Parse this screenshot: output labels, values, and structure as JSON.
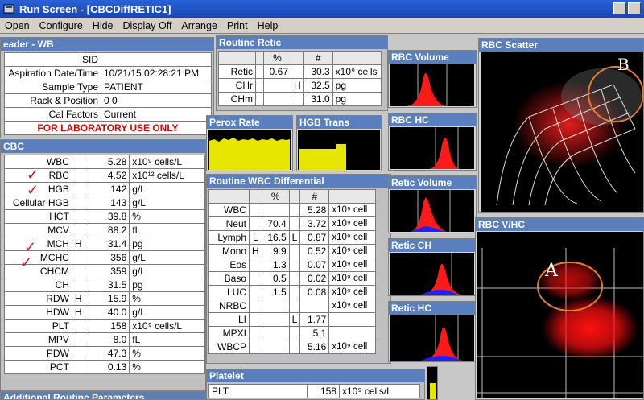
{
  "window": {
    "title": "Run Screen - [CBCDiffRETIC1]"
  },
  "menu": [
    "Open",
    "Configure",
    "Hide",
    "Display Off",
    "Arrange",
    "Print",
    "Help"
  ],
  "header": {
    "title": "eader - WB",
    "rows": [
      {
        "label": "SID",
        "value": ""
      },
      {
        "label": "Aspiration Date/Time",
        "value": "10/21/15 02:28:21 PM"
      },
      {
        "label": "Sample Type",
        "value": "PATIENT"
      },
      {
        "label": "Rack & Position",
        "value": "0 0"
      },
      {
        "label": "Cal Factors",
        "value": "Current"
      }
    ],
    "notice": "FOR LABORATORY USE ONLY"
  },
  "cbc": {
    "title": "CBC",
    "rows": [
      {
        "name": "WBC",
        "flag": "",
        "value": "5.28",
        "unit": "x10⁹ cells/L"
      },
      {
        "name": "RBC",
        "flag": "",
        "value": "4.52",
        "unit": "x10¹² cells/L"
      },
      {
        "name": "HGB",
        "flag": "",
        "value": "142",
        "unit": "g/L"
      },
      {
        "name": "Cellular HGB",
        "flag": "",
        "value": "143",
        "unit": "g/L"
      },
      {
        "name": "HCT",
        "flag": "",
        "value": "39.8",
        "unit": "%"
      },
      {
        "name": "MCV",
        "flag": "",
        "value": "88.2",
        "unit": "fL"
      },
      {
        "name": "MCH",
        "flag": "H",
        "value": "31.4",
        "unit": "pg"
      },
      {
        "name": "MCHC",
        "flag": "",
        "value": "356",
        "unit": "g/L"
      },
      {
        "name": "CHCM",
        "flag": "",
        "value": "359",
        "unit": "g/L"
      },
      {
        "name": "CH",
        "flag": "",
        "value": "31.5",
        "unit": "pg"
      },
      {
        "name": "RDW",
        "flag": "H",
        "value": "15.9",
        "unit": "%"
      },
      {
        "name": "HDW",
        "flag": "H",
        "value": "40.0",
        "unit": "g/L"
      },
      {
        "name": "PLT",
        "flag": "",
        "value": "158",
        "unit": "x10⁹ cells/L"
      },
      {
        "name": "MPV",
        "flag": "",
        "value": "8.0",
        "unit": "fL"
      },
      {
        "name": "PDW",
        "flag": "",
        "value": "47.3",
        "unit": "%"
      },
      {
        "name": "PCT",
        "flag": "",
        "value": "0.13",
        "unit": "%"
      }
    ],
    "checkmark": "✓"
  },
  "additional": {
    "title": "Additional Routine Parameters"
  },
  "retic": {
    "title": "Routine Retic",
    "headers": [
      "%",
      "#"
    ],
    "rows": [
      {
        "name": "Retic",
        "pf": "",
        "pct": "0.67",
        "nf": "",
        "num": "30.3",
        "unit": "x10⁹ cells"
      },
      {
        "name": "CHr",
        "pf": "",
        "pct": "",
        "nf": "H",
        "num": "32.5",
        "unit": "pg"
      },
      {
        "name": "CHm",
        "pf": "",
        "pct": "",
        "nf": "",
        "num": "31.0",
        "unit": "pg"
      }
    ]
  },
  "perox": {
    "title": "Perox Rate"
  },
  "hgbtrans": {
    "title": "HGB Trans"
  },
  "wbcdiff": {
    "title": "Routine WBC Differential",
    "headers": [
      "%",
      "#"
    ],
    "rows": [
      {
        "name": "WBC",
        "pf": "",
        "pct": "",
        "nf": "",
        "num": "5.28",
        "unit": "x10⁹ cell"
      },
      {
        "name": "Neut",
        "pf": "",
        "pct": "70.4",
        "nf": "",
        "num": "3.72",
        "unit": "x10⁹ cell"
      },
      {
        "name": "Lymph",
        "pf": "L",
        "pct": "16.5",
        "nf": "L",
        "num": "0.87",
        "unit": "x10⁹ cell"
      },
      {
        "name": "Mono",
        "pf": "H",
        "pct": "9.9",
        "nf": "",
        "num": "0.52",
        "unit": "x10⁹ cell"
      },
      {
        "name": "Eos",
        "pf": "",
        "pct": "1.3",
        "nf": "",
        "num": "0.07",
        "unit": "x10⁹ cell"
      },
      {
        "name": "Baso",
        "pf": "",
        "pct": "0.5",
        "nf": "",
        "num": "0.02",
        "unit": "x10⁹ cell"
      },
      {
        "name": "LUC",
        "pf": "",
        "pct": "1.5",
        "nf": "",
        "num": "0.08",
        "unit": "x10⁹ cell"
      },
      {
        "name": "NRBC",
        "pf": "",
        "pct": "",
        "nf": "",
        "num": "",
        "unit": "x10⁹ cell"
      },
      {
        "name": "LI",
        "pf": "",
        "pct": "",
        "nf": "L",
        "num": "1.77",
        "unit": ""
      },
      {
        "name": "MPXI",
        "pf": "",
        "pct": "",
        "nf": "",
        "num": "5.1",
        "unit": ""
      },
      {
        "name": "WBCP",
        "pf": "",
        "pct": "",
        "nf": "",
        "num": "5.16",
        "unit": "x10⁹ cell"
      }
    ]
  },
  "platelet": {
    "title": "Platelet",
    "rows": [
      {
        "name": "PLT",
        "value": "158",
        "unit": "x10⁹ cells/L"
      }
    ]
  },
  "histograms": {
    "rbc_volume": "RBC Volume",
    "rbc_hc": "RBC HC",
    "retic_volume": "Retic Volume",
    "retic_ch": "Retic CH",
    "retic_hc": "Retic HC"
  },
  "scatter": {
    "rbc_scatter": {
      "title": "RBC Scatter",
      "annotation": "B"
    },
    "rbc_vhc": {
      "title": "RBC V/HC",
      "annotation": "A"
    }
  },
  "colors": {
    "header_bar": "#5a7fbe",
    "titlebar": "#1a46b4",
    "flag_red": "#e00000",
    "plot_red": "#ff1a1a",
    "annotation": "#e08030",
    "yellow": "#e8e800"
  }
}
